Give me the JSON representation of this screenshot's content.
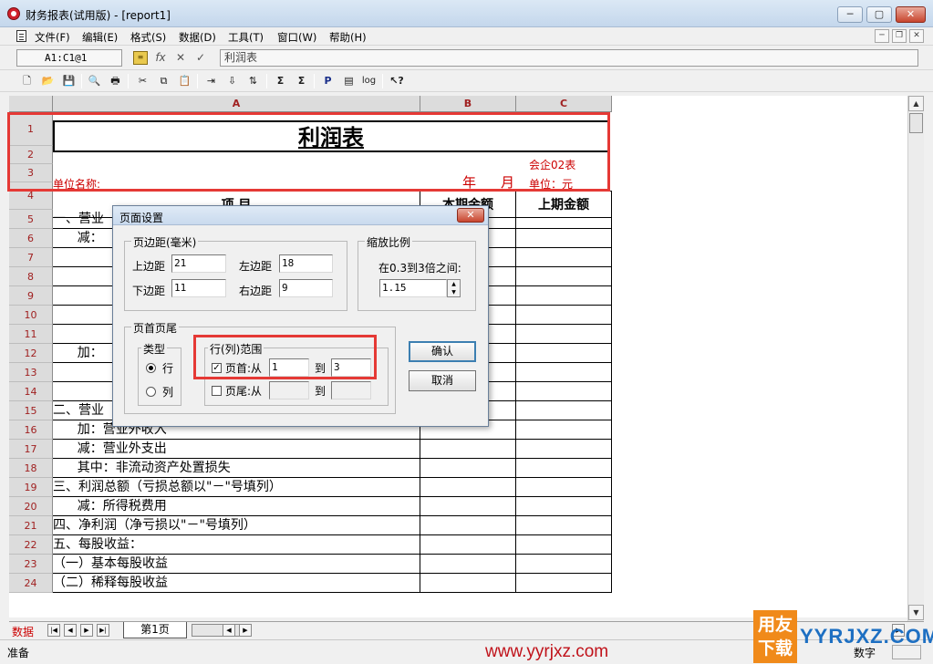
{
  "window": {
    "title": "财务报表(试用版) - [report1]",
    "buttons": [
      "─",
      "▢",
      "✕"
    ]
  },
  "menu": {
    "items": [
      "文件(F)",
      "编辑(E)",
      "格式(S)",
      "数据(D)",
      "工具(T)",
      "窗口(W)",
      "帮助(H)"
    ],
    "mdi_buttons": [
      "─",
      "❐",
      "✕"
    ]
  },
  "formula_bar": {
    "cell_ref": "A1:C1@1",
    "fx": "fx",
    "cancel": "✕",
    "accept": "✓",
    "value": "利润表"
  },
  "toolbar": {
    "icons": [
      {
        "name": "new-file-icon",
        "glyph": "🗋"
      },
      {
        "name": "open-folder-icon",
        "glyph": "📂"
      },
      {
        "name": "save-icon",
        "glyph": "💾"
      },
      {
        "name": "print-preview-icon",
        "glyph": "🔍"
      },
      {
        "name": "print-icon",
        "glyph": "🖶"
      },
      {
        "name": "cut-icon",
        "glyph": "✂"
      },
      {
        "name": "copy-icon",
        "glyph": "⧉"
      },
      {
        "name": "paste-icon",
        "glyph": "📋"
      },
      {
        "name": "insert-icon",
        "glyph": "⇥"
      },
      {
        "name": "fill-down-icon",
        "glyph": "⇩"
      },
      {
        "name": "sort-icon",
        "glyph": "⇅"
      },
      {
        "name": "sum-icon",
        "glyph": "Σ"
      },
      {
        "name": "sum-row-icon",
        "glyph": "Σ"
      },
      {
        "name": "pivot-icon",
        "glyph": "P"
      },
      {
        "name": "page-icon",
        "glyph": "▤"
      },
      {
        "name": "log-icon",
        "glyph": "log"
      },
      {
        "name": "help-pointer-icon",
        "glyph": "↖?"
      }
    ]
  },
  "sheet": {
    "columns": [
      "A",
      "B",
      "C"
    ],
    "rows": [
      "1",
      "2",
      "3",
      "4",
      "5",
      "6",
      "7",
      "8",
      "9",
      "10",
      "11",
      "12",
      "13",
      "14",
      "15",
      "16",
      "17",
      "18",
      "19",
      "20",
      "21",
      "22",
      "23",
      "24"
    ],
    "title": "利润表",
    "form_code": "会企02表",
    "unit_name_label": "单位名称:",
    "year_label": "年",
    "month_label": "月",
    "unit_label": "单位：元",
    "header_item": "项          目",
    "header_current": "本期金额",
    "header_prior": "上期金额",
    "line_items": [
      {
        "row": 5,
        "text": "一、营业"
      },
      {
        "row": 6,
        "text": "      减："
      },
      {
        "row": 12,
        "text": "      加："
      },
      {
        "row": 15,
        "text": "二、营业"
      },
      {
        "row": 16,
        "text": "      加：营业外收入"
      },
      {
        "row": 17,
        "text": "      减：营业外支出"
      },
      {
        "row": 18,
        "text": "      其中：非流动资产处置损失"
      },
      {
        "row": 19,
        "text": "三、利润总额（亏损总额以\"－\"号填列）"
      },
      {
        "row": 20,
        "text": "      减：所得税费用"
      },
      {
        "row": 21,
        "text": "四、净利润（净亏损以\"－\"号填列）"
      },
      {
        "row": 22,
        "text": "五、每股收益："
      },
      {
        "row": 23,
        "text": "（一）基本每股收益"
      },
      {
        "row": 24,
        "text": "（二）稀释每股收益"
      }
    ]
  },
  "dialog": {
    "title": "页面设置",
    "close": "✕",
    "margins": {
      "group_title": "页边距(毫米)",
      "top_label": "上边距",
      "top_value": "21",
      "left_label": "左边距",
      "left_value": "18",
      "bottom_label": "下边距",
      "bottom_value": "11",
      "right_label": "右边距",
      "right_value": "9"
    },
    "scale": {
      "group_title": "缩放比例",
      "hint": "在0.3到3倍之间:",
      "value": "1.15"
    },
    "header_footer": {
      "group_title": "页首页尾",
      "type_title": "类型",
      "type_row": "行",
      "type_col": "列",
      "type_selected": "行",
      "range_title": "行(列)范围",
      "header_label": "页首:从",
      "header_checked": true,
      "header_from": "1",
      "to_label": "到",
      "header_to": "3",
      "footer_label": "页尾:从",
      "footer_checked": false,
      "footer_from": "",
      "footer_to": ""
    },
    "ok_label": "确认",
    "cancel_label": "取消"
  },
  "tabs": {
    "data_label": "数据",
    "nav": [
      "|◀",
      "◀",
      "▶",
      "▶|"
    ],
    "sheet_tab": "第1页"
  },
  "status": {
    "text": "准备",
    "mode": "数字",
    "watermark_url": "www.yyrjxz.com",
    "logo_text": "用友下载",
    "logo_domain": "YYRJXZ.COM"
  },
  "colors": {
    "header_red": "#a02020",
    "label_red": "#cc0000",
    "highlight_red": "#e53935"
  }
}
